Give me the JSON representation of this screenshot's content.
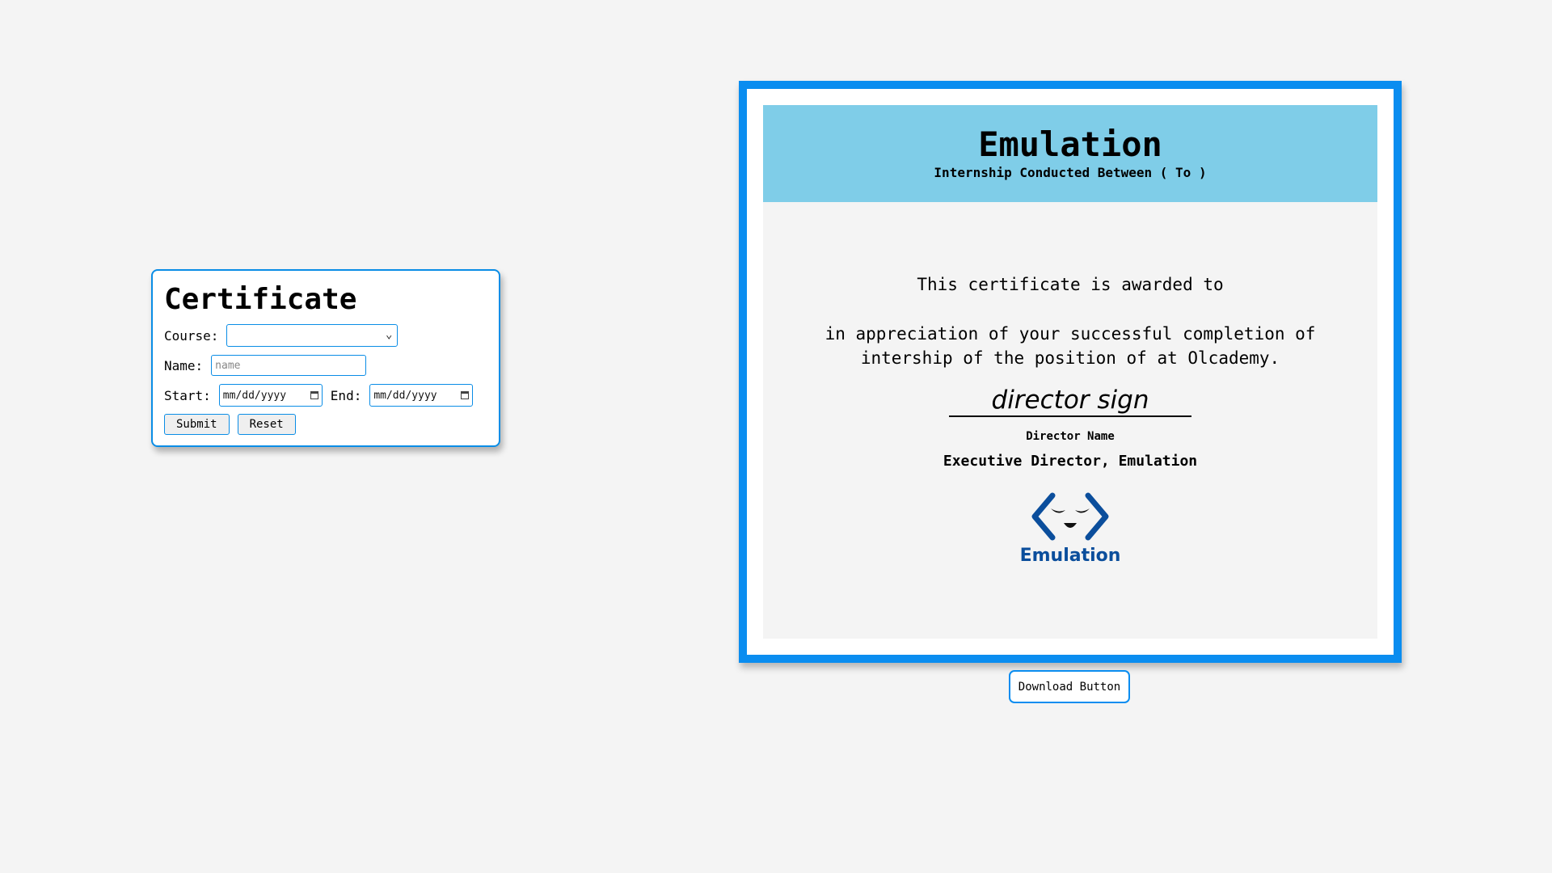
{
  "form": {
    "title": "Certificate",
    "course_label": "Course:",
    "course_value": "",
    "name_label": "Name:",
    "name_placeholder": "name",
    "start_label": "Start:",
    "start_placeholder": "mm/dd/yyyy",
    "end_label": "End:",
    "end_placeholder": "mm/dd/yyyy",
    "submit_label": "Submit",
    "reset_label": "Reset"
  },
  "certificate": {
    "title": "Emulation",
    "subtitle": "Internship Conducted Between ( To )",
    "awarded_text": "This certificate is awarded to",
    "appreciation_text": "in appreciation of your successful completion of intership of the position of at Olcademy.",
    "signature": "director sign",
    "director_name": "Director Name",
    "director_title": "Executive Director, Emulation",
    "logo_text": "Emulation",
    "logo_color": "#0b4e9c",
    "header_color": "#7fcde8",
    "border_color": "#0a8df0"
  },
  "download": {
    "label": "Download Button"
  }
}
